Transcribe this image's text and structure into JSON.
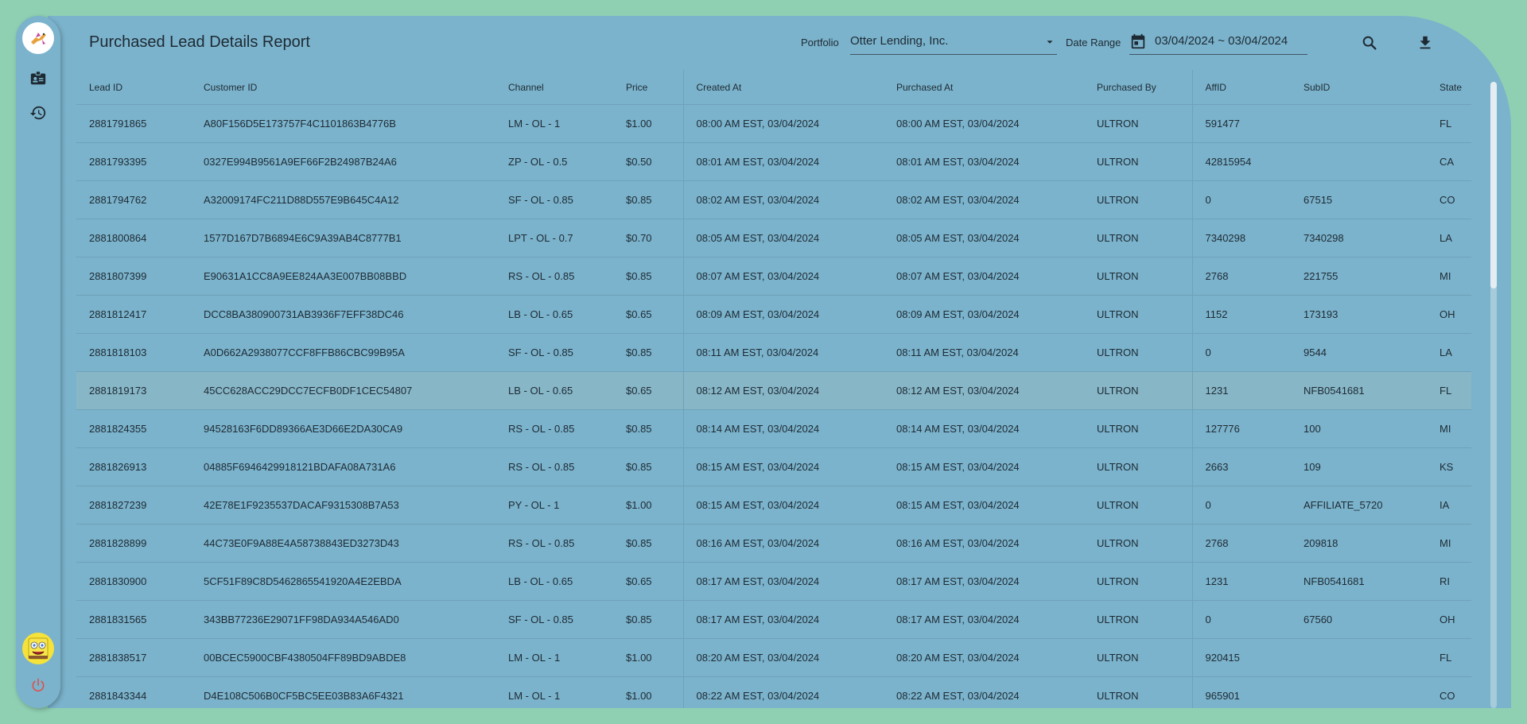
{
  "header": {
    "title": "Purchased Lead Details Report",
    "portfolio_label": "Portfolio",
    "portfolio_value": "Otter Lending, Inc.",
    "date_range_label": "Date Range",
    "date_range_value": "03/04/2024 ~ 03/04/2024"
  },
  "sidebar": {
    "items": [
      {
        "icon": "badge-icon"
      },
      {
        "icon": "history-icon"
      }
    ]
  },
  "colors": {
    "background": "#8fd0b2",
    "panel": "#7bb3cc",
    "power": "#d9534f",
    "highlight_row": "#87b6c7"
  },
  "table": {
    "columns": [
      "Lead ID",
      "Customer ID",
      "Channel",
      "Price",
      "Created At",
      "Purchased At",
      "Purchased By",
      "AffID",
      "SubID",
      "State"
    ],
    "rows": [
      [
        "2881791865",
        "A80F156D5E173757F4C1101863B4776B",
        "LM - OL - 1",
        "$1.00",
        "08:00 AM EST, 03/04/2024",
        "08:00 AM EST, 03/04/2024",
        "ULTRON",
        "591477",
        "",
        "FL"
      ],
      [
        "2881793395",
        "0327E994B9561A9EF66F2B24987B24A6",
        "ZP - OL - 0.5",
        "$0.50",
        "08:01 AM EST, 03/04/2024",
        "08:01 AM EST, 03/04/2024",
        "ULTRON",
        "42815954",
        "",
        "CA"
      ],
      [
        "2881794762",
        "A32009174FC211D88D557E9B645C4A12",
        "SF - OL - 0.85",
        "$0.85",
        "08:02 AM EST, 03/04/2024",
        "08:02 AM EST, 03/04/2024",
        "ULTRON",
        "0",
        "67515",
        "CO"
      ],
      [
        "2881800864",
        "1577D167D7B6894E6C9A39AB4C8777B1",
        "LPT - OL - 0.7",
        "$0.70",
        "08:05 AM EST, 03/04/2024",
        "08:05 AM EST, 03/04/2024",
        "ULTRON",
        "7340298",
        "7340298",
        "LA"
      ],
      [
        "2881807399",
        "E90631A1CC8A9EE824AA3E007BB08BBD",
        "RS - OL - 0.85",
        "$0.85",
        "08:07 AM EST, 03/04/2024",
        "08:07 AM EST, 03/04/2024",
        "ULTRON",
        "2768",
        "221755",
        "MI"
      ],
      [
        "2881812417",
        "DCC8BA380900731AB3936F7EFF38DC46",
        "LB - OL - 0.65",
        "$0.65",
        "08:09 AM EST, 03/04/2024",
        "08:09 AM EST, 03/04/2024",
        "ULTRON",
        "1152",
        "173193",
        "OH"
      ],
      [
        "2881818103",
        "A0D662A2938077CCF8FFB86CBC99B95A",
        "SF - OL - 0.85",
        "$0.85",
        "08:11 AM EST, 03/04/2024",
        "08:11 AM EST, 03/04/2024",
        "ULTRON",
        "0",
        "9544",
        "LA"
      ],
      [
        "2881819173",
        "45CC628ACC29DCC7ECFB0DF1CEC54807",
        "LB - OL - 0.65",
        "$0.65",
        "08:12 AM EST, 03/04/2024",
        "08:12 AM EST, 03/04/2024",
        "ULTRON",
        "1231",
        "NFB0541681",
        "FL"
      ],
      [
        "2881824355",
        "94528163F6DD89366AE3D66E2DA30CA9",
        "RS - OL - 0.85",
        "$0.85",
        "08:14 AM EST, 03/04/2024",
        "08:14 AM EST, 03/04/2024",
        "ULTRON",
        "127776",
        "100",
        "MI"
      ],
      [
        "2881826913",
        "04885F6946429918121BDAFA08A731A6",
        "RS - OL - 0.85",
        "$0.85",
        "08:15 AM EST, 03/04/2024",
        "08:15 AM EST, 03/04/2024",
        "ULTRON",
        "2663",
        "109",
        "KS"
      ],
      [
        "2881827239",
        "42E78E1F9235537DACAF9315308B7A53",
        "PY - OL - 1",
        "$1.00",
        "08:15 AM EST, 03/04/2024",
        "08:15 AM EST, 03/04/2024",
        "ULTRON",
        "0",
        "AFFILIATE_5720",
        "IA"
      ],
      [
        "2881828899",
        "44C73E0F9A88E4A58738843ED3273D43",
        "RS - OL - 0.85",
        "$0.85",
        "08:16 AM EST, 03/04/2024",
        "08:16 AM EST, 03/04/2024",
        "ULTRON",
        "2768",
        "209818",
        "MI"
      ],
      [
        "2881830900",
        "5CF51F89C8D5462865541920A4E2EBDA",
        "LB - OL - 0.65",
        "$0.65",
        "08:17 AM EST, 03/04/2024",
        "08:17 AM EST, 03/04/2024",
        "ULTRON",
        "1231",
        "NFB0541681",
        "RI"
      ],
      [
        "2881831565",
        "343BB77236E29071FF98DA934A546AD0",
        "SF - OL - 0.85",
        "$0.85",
        "08:17 AM EST, 03/04/2024",
        "08:17 AM EST, 03/04/2024",
        "ULTRON",
        "0",
        "67560",
        "OH"
      ],
      [
        "2881838517",
        "00BCEC5900CBF4380504FF89BD9ABDE8",
        "LM - OL - 1",
        "$1.00",
        "08:20 AM EST, 03/04/2024",
        "08:20 AM EST, 03/04/2024",
        "ULTRON",
        "920415",
        "",
        "FL"
      ],
      [
        "2881843344",
        "D4E108C506B0CF5BC5EE03B83A6F4321",
        "LM - OL - 1",
        "$1.00",
        "08:22 AM EST, 03/04/2024",
        "08:22 AM EST, 03/04/2024",
        "ULTRON",
        "965901",
        "",
        "CO"
      ]
    ]
  }
}
